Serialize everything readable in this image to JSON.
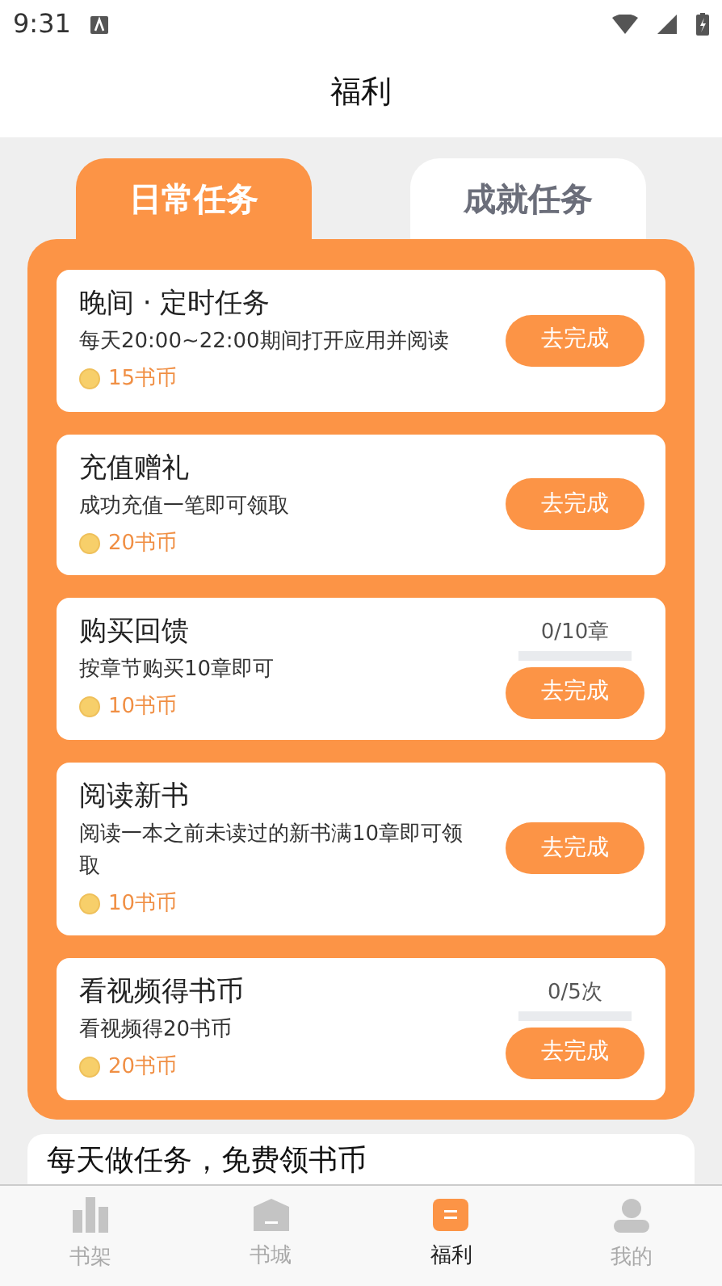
{
  "status_bar": {
    "time": "9:31"
  },
  "header": {
    "title": "福利"
  },
  "tabs": [
    {
      "label": "日常任务",
      "selected": true
    },
    {
      "label": "成就任务",
      "selected": false
    }
  ],
  "tasks": [
    {
      "title": "晚间 · 定时任务",
      "description": "每天20:00~22:00期间打开应用并阅读",
      "reward": "15书币",
      "button": "去完成"
    },
    {
      "title": "充值赠礼",
      "description": "成功充值一笔即可领取",
      "reward": "20书币",
      "button": "去完成"
    },
    {
      "title": "购买回馈",
      "description": "按章节购买10章即可",
      "reward": "10书币",
      "progress": {
        "text": "0/10章",
        "level": 0
      },
      "button": "去完成"
    },
    {
      "title": "阅读新书",
      "description": "阅读一本之前未读过的新书满10章即可领取",
      "reward": "10书币",
      "button": "去完成"
    },
    {
      "title": "看视频得书币",
      "description": "看视频得20书币",
      "reward": "20书币",
      "progress": {
        "text": "0/5次",
        "level": 0
      },
      "button": "去完成"
    }
  ],
  "info_card": {
    "title": "每天做任务，免费领书币"
  },
  "bottom_nav": [
    {
      "label": "书架",
      "kind": "shelf",
      "selected": false
    },
    {
      "label": "书城",
      "kind": "store",
      "selected": false
    },
    {
      "label": "福利",
      "kind": "welfare",
      "selected": true
    },
    {
      "label": "我的",
      "kind": "me",
      "selected": false
    }
  ]
}
